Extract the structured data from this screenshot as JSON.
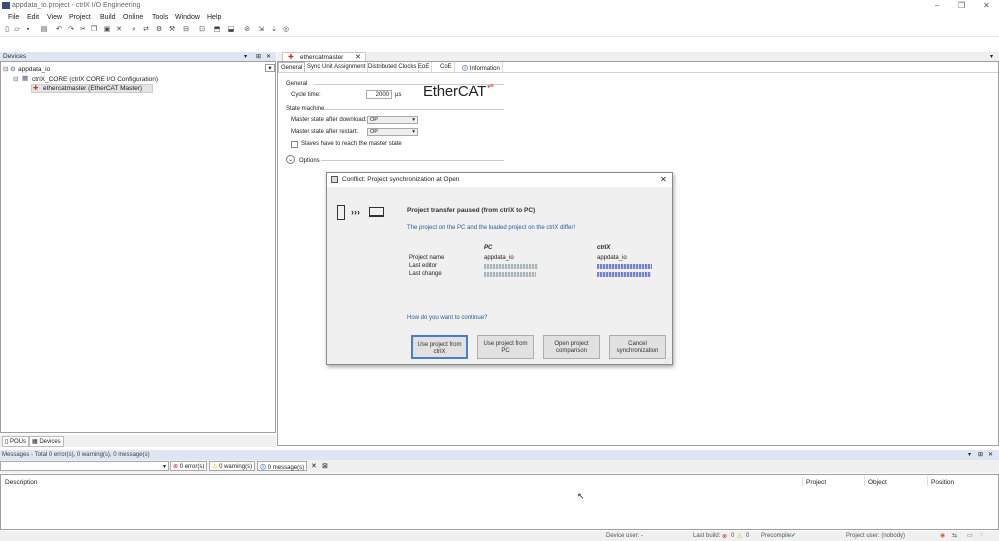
{
  "window": {
    "title": "appdata_io.project - ctrlX I/O Engineering",
    "min": "–",
    "max": "❐",
    "close": "✕"
  },
  "menu": [
    "File",
    "Edit",
    "View",
    "Project",
    "Build",
    "Online",
    "Tools",
    "Window",
    "Help"
  ],
  "devices_panel": {
    "title": "Devices",
    "pin": "▾",
    "dock": "⊞",
    "close": "✕",
    "root": "appdata_io",
    "core": "ctrlX_CORE (ctrlX CORE I/O Configuration)",
    "master": "ethercatmaster (EtherCAT Master)",
    "bottom_tabs": [
      "POUs",
      "Devices"
    ]
  },
  "editor": {
    "doc_tab": "ethercatmaster",
    "close": "✕",
    "tabs": [
      "General",
      "Sync Unit Assignment",
      "Distributed Clocks",
      "EoE",
      "CoE",
      "Information"
    ],
    "general_label": "General",
    "cycle_time_label": "Cycle time:",
    "cycle_time_value": "2000",
    "cycle_time_unit": "µs",
    "ethercat_logo": "EtherCAT",
    "state_machine_label": "State machine",
    "after_download_label": "Master state after download:",
    "after_download_value": "OP",
    "after_restart_label": "Master state after restart:",
    "after_restart_value": "OP",
    "slaves_checkbox": "Slaves have to reach the master state",
    "slaves_checked": false,
    "options_label": "Options"
  },
  "dialog": {
    "title": "Conflict: Project synchronization at Open",
    "close": "✕",
    "heading": "Project transfer paused (from ctrlX to PC)",
    "subheading": "The project on the PC and the loaded project on the ctrlX differ!",
    "col_pc": "PC",
    "col_ctrlx": "ctrlX",
    "rows": [
      {
        "label": "Project name",
        "pc": "appdata_io",
        "ctrlx": "appdata_io"
      },
      {
        "label": "Last editor",
        "pc": "",
        "ctrlx": ""
      },
      {
        "label": "Last change",
        "pc": "",
        "ctrlx": ""
      }
    ],
    "question": "How do you want to continue?",
    "buttons": [
      {
        "line1": "Use project from",
        "line2": "ctrlX"
      },
      {
        "line1": "Use project from",
        "line2": "PC"
      },
      {
        "line1": "Open project",
        "line2": "comparison"
      },
      {
        "line1": "Cancel",
        "line2": "synchronization"
      }
    ]
  },
  "messages": {
    "title": "Messages - Total 0 error(s), 0 warning(s), 0 message(s)",
    "errors": "0 error(s)",
    "warnings": "0 warning(s)",
    "msgs": "0 message(s)",
    "columns": [
      "Description",
      "Project",
      "Object",
      "Position"
    ]
  },
  "status": {
    "device_user": "Device user: -",
    "last_build": "Last build:",
    "build_errors": "0",
    "build_warnings": "0",
    "precompile": "Precompile:",
    "project_user": "Project user: (nobody)"
  },
  "colors": {
    "panel_header": "#dde6f2",
    "accent": "#4a7fc8",
    "error": "#cc2222",
    "warning": "#e0b000"
  }
}
